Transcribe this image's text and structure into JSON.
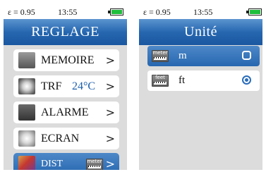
{
  "status": {
    "epsilon": "ε = 0.95",
    "time": "13:55",
    "battery_color": "#1fbe3c"
  },
  "left_screen": {
    "title": "REGLAGE",
    "items": [
      {
        "label": "MEMOIRE",
        "value": "",
        "icon": "memory-icon",
        "chevron": ">"
      },
      {
        "label": "TRF",
        "value": "24°C",
        "icon": "sun-icon",
        "chevron": ">"
      },
      {
        "label": "ALARME",
        "value": "",
        "icon": "bell-icon",
        "chevron": ">"
      },
      {
        "label": "ECRAN",
        "value": "",
        "icon": "brightness-icon",
        "chevron": ">"
      },
      {
        "label": "DIST",
        "value": "",
        "icon": "distance-icon",
        "badge": "meter",
        "chevron": ">",
        "selected": true
      }
    ]
  },
  "right_screen": {
    "title": "Unité",
    "options": [
      {
        "label": "m",
        "badge": "meter",
        "selected": true
      },
      {
        "label": "ft",
        "badge": "feet",
        "selected": false
      }
    ]
  },
  "colors": {
    "accent": "#2767b0",
    "highlight_text": "#1b5fae",
    "panel_bg": "#dcdcdc"
  }
}
